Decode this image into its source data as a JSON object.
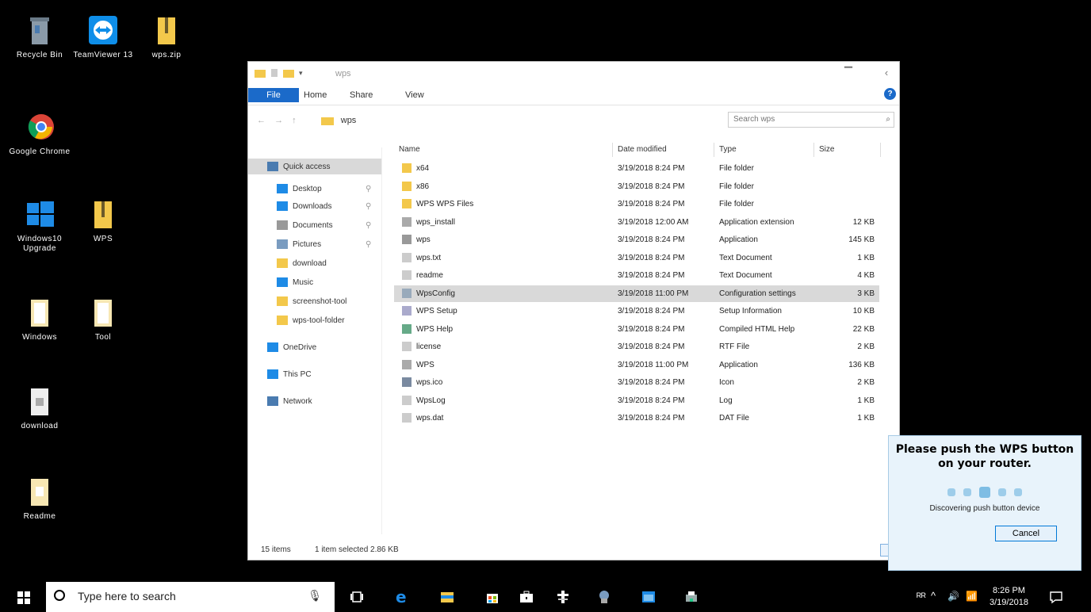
{
  "desktop": {
    "icons": [
      {
        "label": "Recycle Bin",
        "name": "recycle-bin"
      },
      {
        "label": "TeamViewer 13",
        "name": "teamviewer"
      },
      {
        "label": "wps.zip",
        "name": "zip-folder-1"
      },
      {
        "label": "Google Chrome",
        "name": "chrome"
      },
      {
        "label": "Windows10 Upgrade",
        "name": "windows-upgrade"
      },
      {
        "label": "WPS",
        "name": "zip-folder-2"
      },
      {
        "label": "Windows",
        "name": "folder-windows"
      },
      {
        "label": "Tool",
        "name": "folder-tool"
      },
      {
        "label": "download",
        "name": "file-download"
      },
      {
        "label": "Readme",
        "name": "file-readme"
      }
    ]
  },
  "explorer": {
    "title": "wps",
    "ribbon_tabs": [
      "File",
      "Home",
      "Share",
      "View"
    ],
    "address": "wps",
    "search_placeholder": "Search wps",
    "nav_items": [
      {
        "label": "Quick access",
        "selected": true,
        "pinned": false
      },
      {
        "label": "Desktop",
        "selected": false,
        "pinned": true
      },
      {
        "label": "Downloads",
        "selected": false,
        "pinned": true
      },
      {
        "label": "Documents",
        "selected": false,
        "pinned": true
      },
      {
        "label": "Pictures",
        "selected": false,
        "pinned": true
      },
      {
        "label": "download",
        "selected": false,
        "pinned": false
      },
      {
        "label": "Music",
        "selected": false,
        "pinned": false
      },
      {
        "label": "screenshot-tool",
        "selected": false,
        "pinned": false
      },
      {
        "label": "wps-tool-folder",
        "selected": false,
        "pinned": false
      },
      {
        "label": "OneDrive",
        "selected": false,
        "pinned": false
      },
      {
        "label": "This PC",
        "selected": false,
        "pinned": false
      },
      {
        "label": "Network",
        "selected": false,
        "pinned": false
      }
    ],
    "columns": [
      "Name",
      "Date modified",
      "Type",
      "Size"
    ],
    "files": [
      {
        "name": "x64",
        "date": "3/19/2018 8:24 PM",
        "type": "File folder",
        "size": "",
        "icon": "folder"
      },
      {
        "name": "x86",
        "date": "3/19/2018 8:24 PM",
        "type": "File folder",
        "size": "",
        "icon": "folder"
      },
      {
        "name": "WPS WPS Files",
        "date": "3/19/2018 8:24 PM",
        "type": "File folder",
        "size": "",
        "icon": "folder"
      },
      {
        "name": "wps_install",
        "date": "3/19/2018 12:00 AM",
        "type": "Application extension",
        "size": "12 KB",
        "icon": "app"
      },
      {
        "name": "wps",
        "date": "3/19/2018 8:24 PM",
        "type": "Application",
        "size": "145 KB",
        "icon": "exe"
      },
      {
        "name": "wps.txt",
        "date": "3/19/2018 8:24 PM",
        "type": "Text Document",
        "size": "1 KB",
        "icon": "doc"
      },
      {
        "name": "readme",
        "date": "3/19/2018 8:24 PM",
        "type": "Text Document",
        "size": "4 KB",
        "icon": "doc"
      },
      {
        "name": "WpsConfig",
        "date": "3/19/2018 11:00 PM",
        "type": "Configuration settings",
        "size": "3 KB",
        "icon": "config",
        "selected": true
      },
      {
        "name": "WPS Setup",
        "date": "3/19/2018 8:24 PM",
        "type": "Setup Information",
        "size": "10 KB",
        "icon": "setup"
      },
      {
        "name": "WPS Help",
        "date": "3/19/2018 8:24 PM",
        "type": "Compiled HTML Help",
        "size": "22 KB",
        "icon": "help"
      },
      {
        "name": "license",
        "date": "3/19/2018 8:24 PM",
        "type": "RTF File",
        "size": "2 KB",
        "icon": "doc"
      },
      {
        "name": "WPS",
        "date": "3/19/2018 11:00 PM",
        "type": "Application",
        "size": "136 KB",
        "icon": "app"
      },
      {
        "name": "wps.ico",
        "date": "3/19/2018 8:24 PM",
        "type": "Icon",
        "size": "2 KB",
        "icon": "image"
      },
      {
        "name": "WpsLog",
        "date": "3/19/2018 8:24 PM",
        "type": "Log",
        "size": "1 KB",
        "icon": "doc"
      },
      {
        "name": "wps.dat",
        "date": "3/19/2018 8:24 PM",
        "type": "DAT File",
        "size": "1 KB",
        "icon": "doc"
      }
    ],
    "status_items": "15 items",
    "status_selected": "1 item selected  2.86 KB"
  },
  "wps_popup": {
    "message": "Please push the WPS button on your router.",
    "status": "Discovering push button device",
    "cancel_label": "Cancel"
  },
  "taskbar": {
    "search_placeholder": "Type here to search",
    "time": "8:26 PM",
    "date": "3/19/2018"
  }
}
